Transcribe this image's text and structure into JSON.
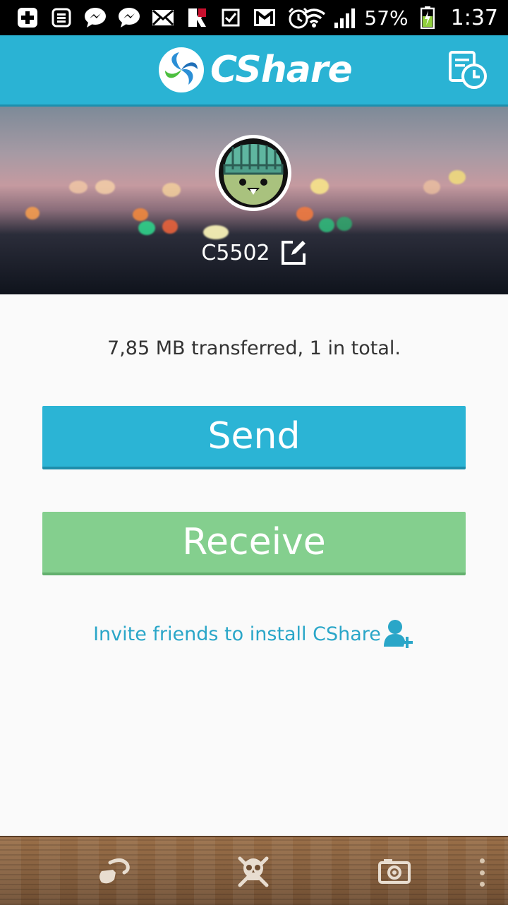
{
  "status_bar": {
    "battery": "57%",
    "time": "1:37",
    "icons": [
      "add-icon",
      "notes-icon",
      "messenger-icon",
      "messenger-icon",
      "mail-icon",
      "antivirus-icon",
      "checkbox-icon",
      "gmail-icon",
      "alarm-icon",
      "wifi-icon",
      "signal-icon",
      "battery-icon"
    ]
  },
  "header": {
    "logo_text": "CShare",
    "history_icon": "history-icon"
  },
  "profile": {
    "device_name": "C5502",
    "edit_icon": "edit-icon"
  },
  "stats_text": "7,85 MB transferred, 1 in total.",
  "actions": {
    "send_label": "Send",
    "receive_label": "Receive"
  },
  "invite_text": "Invite friends to install CShare",
  "bottom_nav": {
    "icons": [
      "hook-icon",
      "skull-icon",
      "camera-icon",
      "more-icon"
    ]
  },
  "colors": {
    "brand": "#2ab3d4",
    "send": "#2bb4d5",
    "receive": "#84cf8e",
    "link": "#2aa6c8"
  }
}
